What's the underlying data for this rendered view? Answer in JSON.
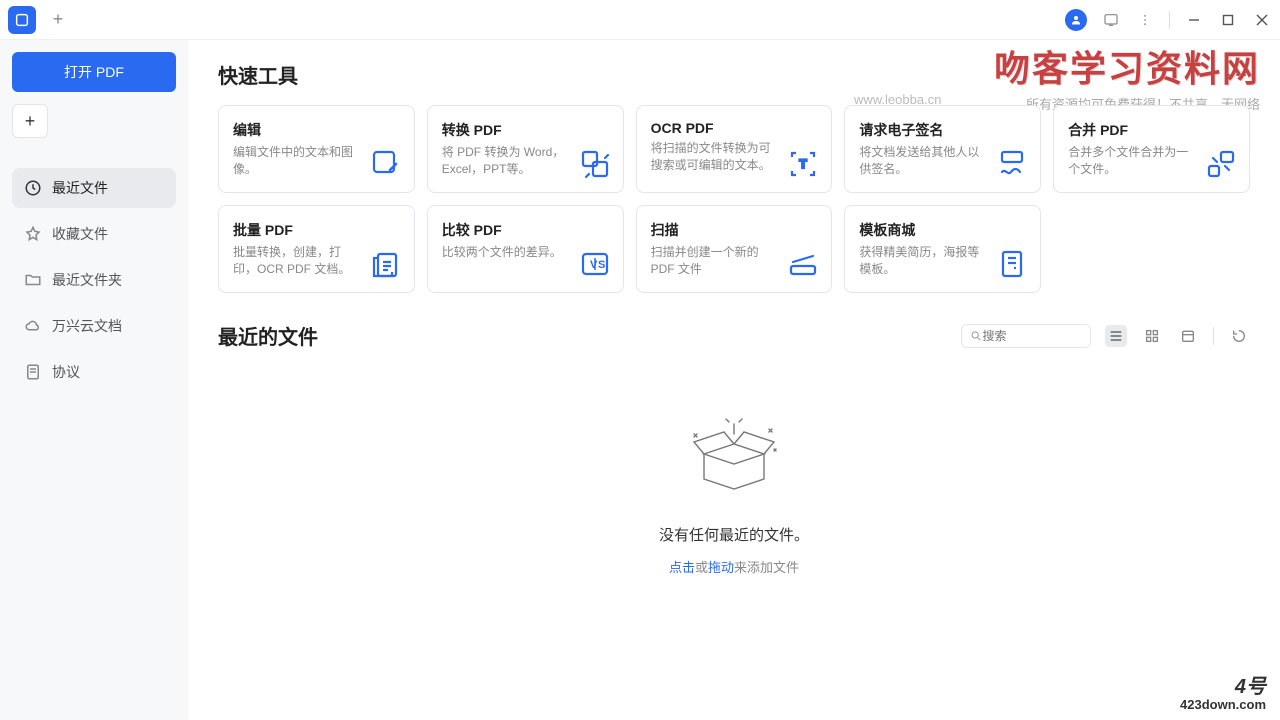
{
  "titlebar": {
    "tab_add": "+",
    "avatar_glyph": "人"
  },
  "sidebar": {
    "open_label": "打开 PDF",
    "plus_label": "+",
    "items": [
      {
        "label": "最近文件",
        "active": true
      },
      {
        "label": "收藏文件"
      },
      {
        "label": "最近文件夹"
      },
      {
        "label": "万兴云文档"
      },
      {
        "label": "协议"
      }
    ]
  },
  "tools": {
    "title": "快速工具",
    "more": "···",
    "cards": [
      {
        "title": "编辑",
        "desc": "编辑文件中的文本和图像。"
      },
      {
        "title": "转换 PDF",
        "desc": "将 PDF 转换为 Word，Excel，PPT等。"
      },
      {
        "title": "OCR PDF",
        "desc": "将扫描的文件转换为可搜索或可编辑的文本。"
      },
      {
        "title": "请求电子签名",
        "desc": "将文档发送给其他人以供签名。"
      },
      {
        "title": "合并 PDF",
        "desc": "合并多个文件合并为一个文件。"
      },
      {
        "title": "批量 PDF",
        "desc": "批量转换，创建，打印，OCR PDF 文档。"
      },
      {
        "title": "比较 PDF",
        "desc": "比较两个文件的差异。"
      },
      {
        "title": "扫描",
        "desc": "扫描并创建一个新的 PDF 文件"
      },
      {
        "title": "模板商城",
        "desc": "获得精美简历，海报等模板。"
      }
    ]
  },
  "recent": {
    "title": "最近的文件",
    "search_placeholder": "搜索",
    "empty_title": "没有任何最近的文件。",
    "empty_hint_click": "点击",
    "empty_hint_or": "或",
    "empty_hint_drag": "拖动",
    "empty_hint_suffix": "来添加文件"
  },
  "watermark": {
    "big": "吻客学习资料网",
    "url": "www.leobba.cn",
    "small": "所有资源均可免费获得！不共享、无网络",
    "br_logo": "4号",
    "br_text": "423down.com"
  }
}
